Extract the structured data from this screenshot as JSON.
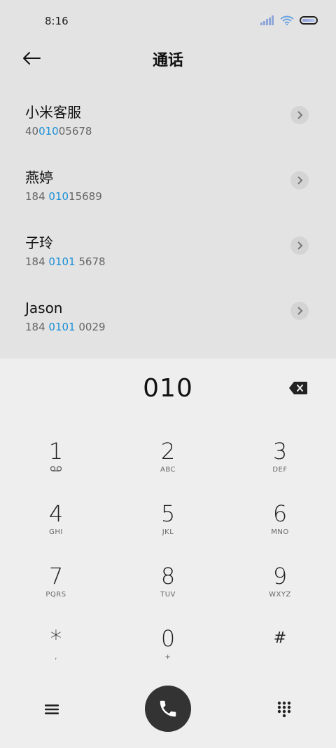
{
  "status_bar": {
    "time": "8:16"
  },
  "header": {
    "title": "通话"
  },
  "results": [
    {
      "name": "小米客服",
      "number_pre": "40",
      "number_hl": "010",
      "number_post": "05678"
    },
    {
      "name": "燕婷",
      "number_pre": "184 ",
      "number_hl": "010",
      "number_post": "15689"
    },
    {
      "name": "子玲",
      "number_pre": "184 ",
      "number_hl": "0101",
      "number_post": " 5678"
    },
    {
      "name": "Jason",
      "number_pre": "184 ",
      "number_hl": "0101",
      "number_post": " 0029"
    }
  ],
  "dialer": {
    "entered": "010",
    "keys": [
      {
        "digit": "1",
        "sub": ""
      },
      {
        "digit": "2",
        "sub": "ABC"
      },
      {
        "digit": "3",
        "sub": "DEF"
      },
      {
        "digit": "4",
        "sub": "GHI"
      },
      {
        "digit": "5",
        "sub": "JKL"
      },
      {
        "digit": "6",
        "sub": "MNO"
      },
      {
        "digit": "7",
        "sub": "PQRS"
      },
      {
        "digit": "8",
        "sub": "TUV"
      },
      {
        "digit": "9",
        "sub": "WXYZ"
      },
      {
        "digit": "*",
        "sub": ","
      },
      {
        "digit": "0",
        "sub": "+"
      },
      {
        "digit": "#",
        "sub": ""
      }
    ]
  },
  "colors": {
    "highlight": "#1a8fd6",
    "call_button": "#333333",
    "background_top": "#e3e3e3",
    "background_dialer": "#eeeeee"
  },
  "icons": {
    "back": "arrow-left-icon",
    "chevron": "chevron-right-icon",
    "backspace": "backspace-icon",
    "voicemail": "voicemail-icon",
    "menu": "menu-icon",
    "call": "phone-icon",
    "keypad": "keypad-icon"
  }
}
